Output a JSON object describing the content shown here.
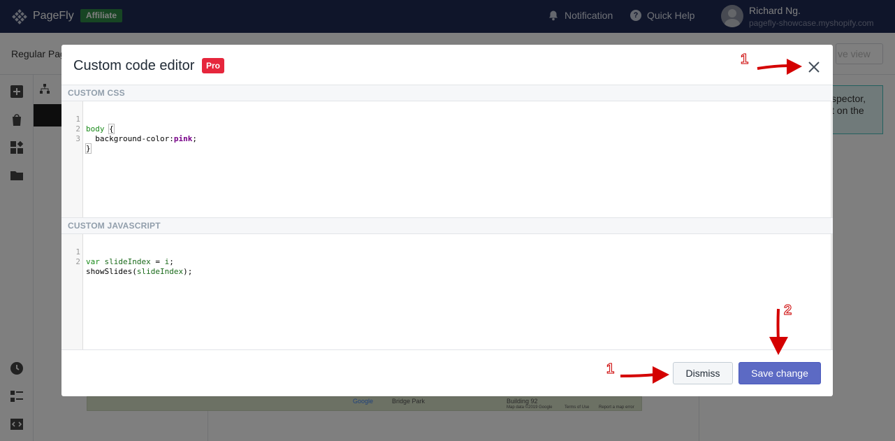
{
  "app": {
    "name": "PageFly",
    "badge": "Affiliate"
  },
  "topbar": {
    "notification_label": "Notification",
    "help_label": "Quick Help",
    "user_name": "Richard Ng.",
    "user_shop": "pagefly-showcase.myshopify.com"
  },
  "background": {
    "page_type": "Regular Pag",
    "live_view_label": "ve view",
    "inspector_tip_line1": "spector,",
    "inspector_tip_line2": "t on the",
    "map_labels": [
      "Google",
      "Bridge Park",
      "Building 92"
    ],
    "map_footer": [
      "Map data ©2019 Google",
      "Terms of Use",
      "Report a map error"
    ]
  },
  "modal": {
    "title": "Custom code editor",
    "pro_badge": "Pro",
    "css_section_label": "CUSTOM CSS",
    "js_section_label": "CUSTOM JAVASCRIPT",
    "css_lines": [
      {
        "num": "1",
        "text": "body {"
      },
      {
        "num": "2",
        "text": "  background-color:pink;"
      },
      {
        "num": "3",
        "text": "}"
      }
    ],
    "js_lines": [
      {
        "num": "1",
        "text": "var slideIndex = i;"
      },
      {
        "num": "2",
        "text": "showSlides(slideIndex);"
      }
    ],
    "dismiss_label": "Dismiss",
    "save_label": "Save change"
  },
  "annotations": {
    "close_marker": "1",
    "dismiss_marker": "1",
    "save_marker": "2",
    "arrow_color": "#d40000"
  },
  "colors": {
    "topbar_bg": "#1e2a55",
    "affiliate_bg": "#2e8a46",
    "pro_bg": "#e6263c",
    "save_bg": "#5c6ac4"
  }
}
